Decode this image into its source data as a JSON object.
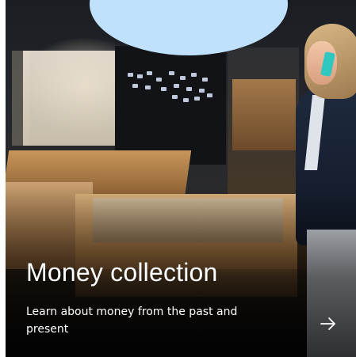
{
  "card": {
    "title": "Money collection",
    "description": "Learn about money from the past and present",
    "arrow_icon": "arrow-right-icon",
    "decorative_shape_color": "#bfe1fb",
    "text_color": "#ffffff"
  }
}
